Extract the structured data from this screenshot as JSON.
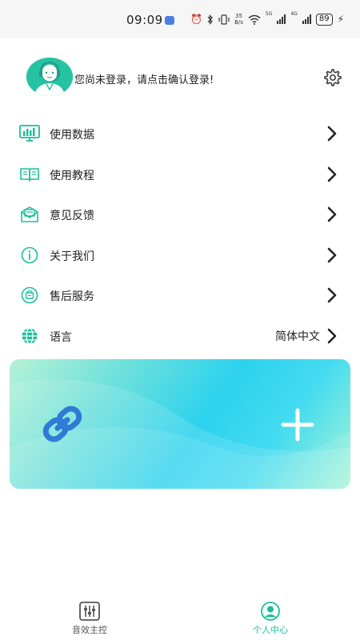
{
  "status_bar": {
    "time": "09:09",
    "net_speed_value": "35",
    "net_speed_unit": "B/s",
    "network_5g": "5G",
    "network_4g": "4G",
    "battery": "89",
    "icons": [
      "app-notification-icon",
      "alarm-icon",
      "bluetooth-icon",
      "vibrate-icon",
      "wifi-icon",
      "signal-icon",
      "charging-icon"
    ]
  },
  "profile": {
    "login_prompt": "您尚未登录，请点击确认登录!",
    "avatar_icon": "user-avatar-icon",
    "settings_icon": "gear-icon"
  },
  "menu": {
    "items": [
      {
        "label": "使用数据",
        "icon": "usage-data-icon"
      },
      {
        "label": "使用教程",
        "icon": "tutorial-book-icon"
      },
      {
        "label": "意见反馈",
        "icon": "feedback-mail-icon"
      },
      {
        "label": "关于我们",
        "icon": "info-icon"
      },
      {
        "label": "售后服务",
        "icon": "after-sales-icon"
      },
      {
        "label": "语言",
        "icon": "globe-icon",
        "value": "简体中文"
      }
    ]
  },
  "card": {
    "link_icon": "link-icon",
    "add_icon": "plus-icon"
  },
  "tabbar": {
    "tabs": [
      {
        "label": "音效主控",
        "icon": "equalizer-icon",
        "active": false
      },
      {
        "label": "个人中心",
        "icon": "person-icon",
        "active": true
      }
    ]
  },
  "colors": {
    "accent": "#1bbf9a",
    "avatar_bg": "#26c3a3",
    "link_icon": "#2f7bd6",
    "card_gradient": [
      "#b7f2d6",
      "#2cd2ee",
      "#a8f5d6"
    ]
  }
}
